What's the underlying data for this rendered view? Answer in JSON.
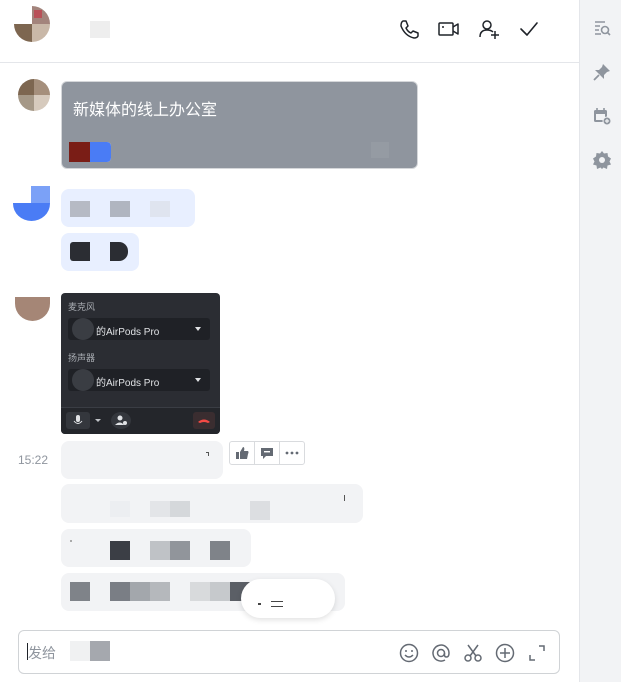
{
  "header": {
    "actions": [
      {
        "name": "phone-icon"
      },
      {
        "name": "video-icon"
      },
      {
        "name": "add-member-icon"
      },
      {
        "name": "checkmark-icon"
      }
    ]
  },
  "sidebar": {
    "items": [
      {
        "name": "search-history-icon"
      },
      {
        "name": "pin-icon"
      },
      {
        "name": "calendar-add-icon"
      },
      {
        "name": "settings-gear-icon"
      }
    ]
  },
  "messages": {
    "card_title": "新媒体的线上办公室",
    "device": {
      "mic_label": "麦克风",
      "mic_value": "的AirPods Pro",
      "speaker_label": "扬声器",
      "speaker_value": "的AirPods Pro"
    },
    "timestamp": "15:22",
    "reactions": [
      {
        "name": "thumbs-up-icon"
      },
      {
        "name": "comment-icon"
      },
      {
        "name": "more-icon"
      }
    ]
  },
  "composer": {
    "placeholder": "发给",
    "tools": [
      {
        "name": "emoji-icon"
      },
      {
        "name": "mention-icon"
      },
      {
        "name": "scissors-icon"
      },
      {
        "name": "add-circle-icon"
      },
      {
        "name": "expand-icon"
      }
    ]
  },
  "colors": {
    "accent": "#3370ff",
    "card_gray": "#8f959e",
    "bubble_gray": "#f2f3f5",
    "bubble_blue": "#e8efff",
    "device_dark": "#2b2d33",
    "hangup_red": "#f54a45"
  }
}
